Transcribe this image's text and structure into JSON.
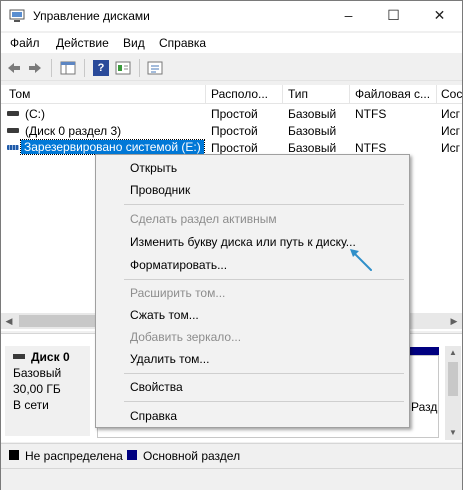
{
  "window": {
    "title": "Управление дисками",
    "controls": {
      "minimize": "–",
      "maximize": "☐",
      "close": "✕"
    }
  },
  "menu": [
    "Файл",
    "Действие",
    "Вид",
    "Справка"
  ],
  "toolbar": {
    "icons": [
      "back-arrow-icon",
      "forward-arrow-icon",
      "console-tree-icon",
      "help-icon",
      "properties-icon",
      "list-view-icon"
    ],
    "help_glyph": "?"
  },
  "volumes_table": {
    "columns": [
      "Том",
      "Располо...",
      "Тип",
      "Файловая с...",
      "Сос"
    ],
    "rows": [
      {
        "name": "(C:)",
        "layout": "Простой",
        "type": "Базовый",
        "fs": "NTFS",
        "status": "Исг"
      },
      {
        "name": "(Диск 0 раздел 3)",
        "layout": "Простой",
        "type": "Базовый",
        "fs": "",
        "status": "Исг"
      },
      {
        "name": "Зарезервировано системой (E:)",
        "layout": "Простой",
        "type": "Базовый",
        "fs": "NTFS",
        "status": "Исг"
      }
    ]
  },
  "disk": {
    "name": "Диск 0",
    "kind": "Базовый",
    "size": "30,00 ГБ",
    "state": "В сети",
    "partition_fragment": "Разд"
  },
  "legend": [
    {
      "label": "Не распределена",
      "color": "#000000"
    },
    {
      "label": "Основной раздел",
      "color": "#000080"
    }
  ],
  "context_menu": {
    "items": [
      {
        "label": "Открыть",
        "enabled": true
      },
      {
        "label": "Проводник",
        "enabled": true
      },
      {
        "label": "Сделать раздел активным",
        "enabled": false
      },
      {
        "label": "Изменить букву диска или путь к диску...",
        "enabled": true
      },
      {
        "label": "Форматировать...",
        "enabled": true
      },
      {
        "label": "Расширить том...",
        "enabled": false
      },
      {
        "label": "Сжать том...",
        "enabled": true
      },
      {
        "label": "Добавить зеркало...",
        "enabled": false
      },
      {
        "label": "Удалить том...",
        "enabled": true
      },
      {
        "label": "Свойства",
        "enabled": true
      },
      {
        "label": "Справка",
        "enabled": true
      }
    ]
  },
  "colors": {
    "selection": "#0078d7",
    "primary_partition": "#000080",
    "annotation_arrow": "#2f8fc9"
  }
}
